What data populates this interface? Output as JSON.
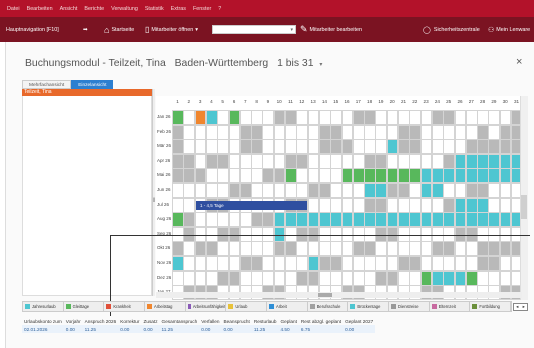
{
  "menu": [
    "Datei",
    "Bearbeiten",
    "Ansicht",
    "Berichte",
    "Verwaltung",
    "Statistik",
    "Extras",
    "Fenster",
    "?"
  ],
  "toolbar": {
    "main_menu": "Hauptnavigation [F10]",
    "start": "Startseite",
    "open_staff": "Mitarbeiter öffnen",
    "edit_staff": "Mitarbeiter bearbeiten",
    "security": "Sicherheitszentrale",
    "user": "Mein Lenware"
  },
  "module": {
    "title": "Buchungsmodul - Teilzeit, Tina",
    "state": "Baden-Württemberg",
    "range": "1 bis 31",
    "close": "×"
  },
  "tabs": [
    "Mehrfachansicht",
    "Einzelansicht"
  ],
  "person": "Teilzeit, Tina",
  "popup": "1 - 4,5 Tage",
  "days": [
    1,
    2,
    3,
    4,
    5,
    6,
    7,
    8,
    9,
    10,
    11,
    12,
    13,
    14,
    15,
    16,
    17,
    18,
    19,
    20,
    21,
    22,
    23,
    24,
    25,
    26,
    27,
    28,
    29,
    30,
    31
  ],
  "months": [
    "Jan 26",
    "Feb 26",
    "Mär 26",
    "Apr 26",
    "Mai 26",
    "Jun 26",
    "Jul 26",
    "Aug 26",
    "Sep 26",
    "Okt 26",
    "Nov 26",
    "Dez 26",
    "Jan 27"
  ],
  "colors": {
    "menubar": "#b3122a",
    "toolbar": "#7b1322",
    "vacation": "#4ec6d1",
    "weekend": "#b9b9b9",
    "holiday": "#58b85c",
    "selected": "#f0862e",
    "empty": "#ffffff",
    "popup": "#2f4fa0"
  },
  "legend": [
    "Jahresurlaub",
    "Gleittage",
    "Krankheit",
    "Arbeitstag",
    "Arbeitsunfähigkeit",
    "Urlaub",
    "Arbeit",
    "Berufsschule",
    "Brückentage",
    "Dienstreise",
    "Elternzeit",
    "Fortbildung"
  ],
  "account": {
    "headers": [
      "Urlaubskonto zum",
      "Vorjahr",
      "Anspruch 2026",
      "Korrektur",
      "Zusatz",
      "Gesamtanspruch",
      "Verfallen",
      "Beansprucht",
      "Resturlaub",
      "Geplant",
      "Rest abzgl. geplant",
      "Geplant 2027"
    ],
    "values": [
      "02.01.2026",
      "0.00",
      "11.25",
      "0.00",
      "0.00",
      "11.25",
      "0.00",
      "0.00",
      "11.25",
      "4.50",
      "6.75",
      "0.00"
    ]
  }
}
